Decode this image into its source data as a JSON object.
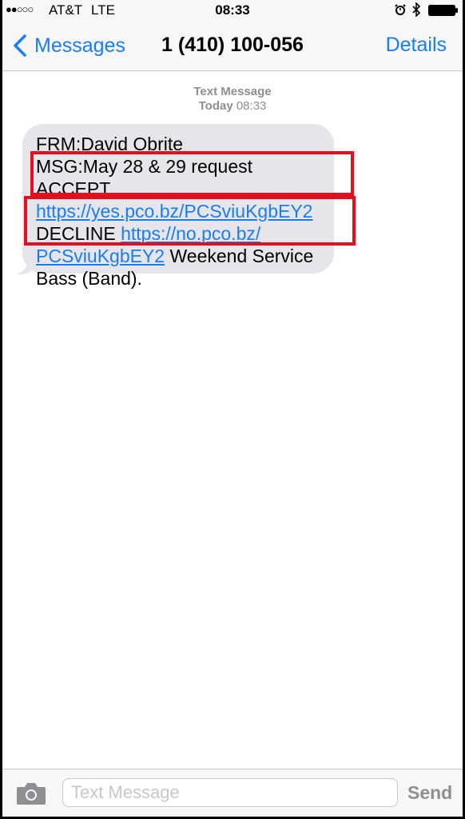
{
  "status_bar": {
    "signal": "●●○○○",
    "carrier": "AT&T",
    "network": "LTE",
    "time": "08:33"
  },
  "nav": {
    "back_label": "Messages",
    "title": "1 (410) 100-056",
    "details_label": "Details"
  },
  "conversation": {
    "timestamp_label": "Text Message",
    "timestamp_day": "Today",
    "timestamp_time": "08:33",
    "message": {
      "line1": "FRM:David Obrite",
      "line2": "MSG:May 28 & 29 request ACCEPT",
      "accept_link": "https://yes.pco.bz/PCSviuKgbEY2",
      "decline_label": "DECLINE",
      "decline_link_part1": "https://no.pco.bz/",
      "decline_link_part2": "PCSviuKgbEY2",
      "after_link": "Weekend Service",
      "last_line": "Bass (Band)."
    }
  },
  "input_bar": {
    "placeholder": "Text Message",
    "send_label": "Send"
  },
  "colors": {
    "accent": "#1a7ef0",
    "bubble": "#e5e5ea",
    "highlight": "#e01020"
  }
}
